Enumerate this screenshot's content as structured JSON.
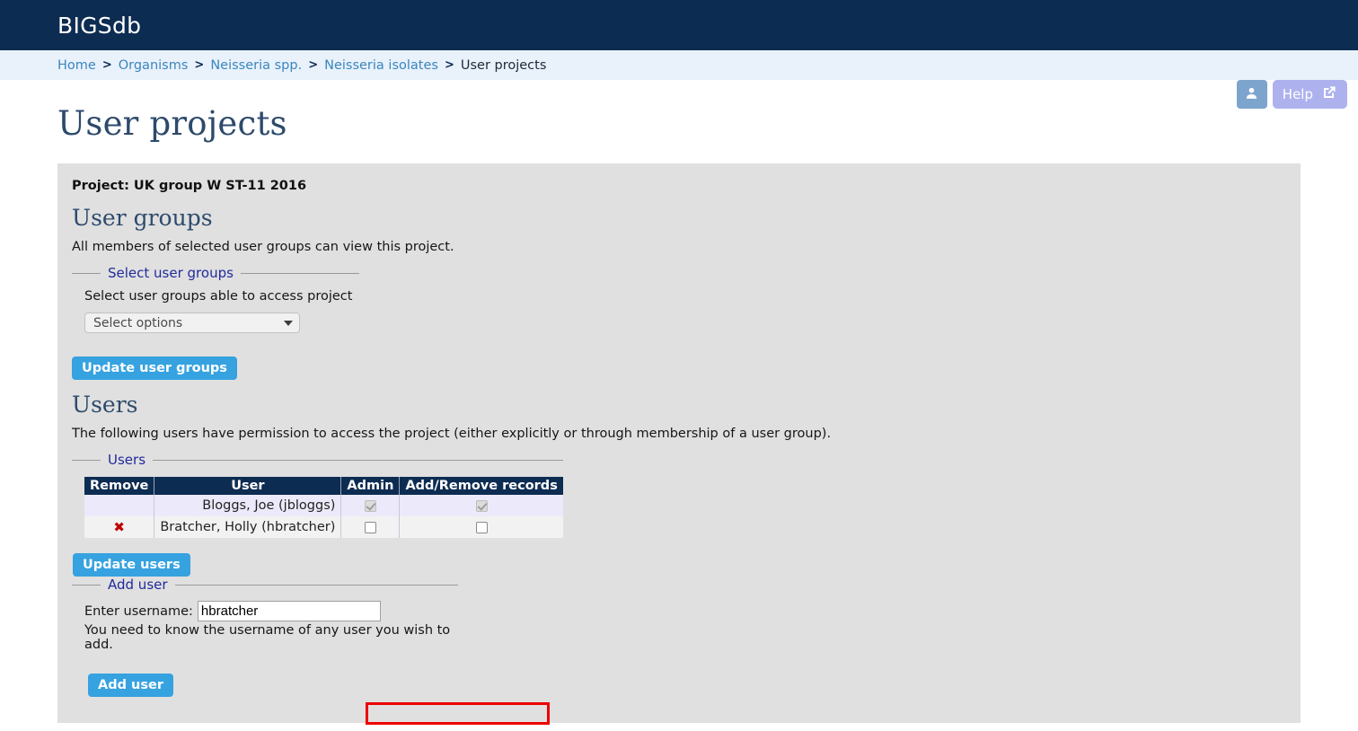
{
  "header": {
    "brand": "BIGSdb"
  },
  "breadcrumb": {
    "separator": ">",
    "items": [
      {
        "label": "Home",
        "current": false
      },
      {
        "label": "Organisms",
        "current": false
      },
      {
        "label": "Neisseria spp.",
        "current": false
      },
      {
        "label": "Neisseria isolates",
        "current": false
      },
      {
        "label": "User projects",
        "current": true
      }
    ]
  },
  "utility": {
    "user_icon": "user-account-icon",
    "help_label": "Help",
    "help_icon": "external-link-icon"
  },
  "page": {
    "title": "User projects"
  },
  "panel": {
    "project_label": "Project: UK group W ST-11 2016",
    "user_groups": {
      "heading": "User groups",
      "description": "All members of selected user groups can view this project.",
      "fieldset_legend": "Select user groups",
      "field_label": "Select user groups able to access project",
      "select_value": "Select options",
      "select_caret_icon": "chevron-down-icon",
      "update_button": "Update user groups"
    },
    "users": {
      "heading": "Users",
      "description": "The following users have permission to access the project (either explicitly or through membership of a user group).",
      "fieldset_legend": "Users",
      "table": {
        "columns": [
          "Remove",
          "User",
          "Admin",
          "Add/Remove records"
        ],
        "rows": [
          {
            "remove_icon": "",
            "user": "Bloggs, Joe (jbloggs)",
            "admin": "checked-disabled",
            "records": "checked-disabled"
          },
          {
            "remove_icon": "✖",
            "user": "Bratcher, Holly (hbratcher)",
            "admin": "unchecked",
            "records": "unchecked"
          }
        ]
      },
      "update_button": "Update users"
    },
    "add_user": {
      "fieldset_legend": "Add user",
      "username_label": "Enter username:",
      "username_value": "hbratcher",
      "username_placeholder": "",
      "hint": "You need to know the username of any user you wish to add.",
      "add_button": "Add user"
    }
  },
  "annotation": {
    "highlight_color": "#ee0000"
  }
}
